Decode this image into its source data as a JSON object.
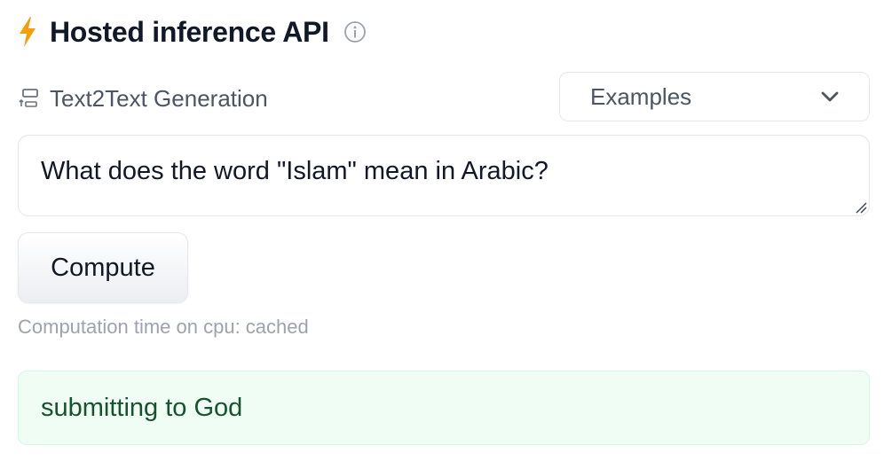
{
  "header": {
    "title": "Hosted inference API",
    "bolt_icon": "lightning-bolt-icon",
    "info_icon": "info-circle-icon",
    "accent_color": "#f59e0b"
  },
  "task": {
    "icon": "text2text-icon",
    "label": "Text2Text Generation"
  },
  "examples": {
    "label": "Examples",
    "icon": "chevron-down-icon"
  },
  "input": {
    "value": "What does the word \"Islam\" mean in Arabic?"
  },
  "compute": {
    "label": "Compute"
  },
  "status": {
    "computation_time": "Computation time on cpu: cached"
  },
  "output": {
    "text": "submitting to God",
    "background_color": "#f0fdf4",
    "text_color": "#14532d"
  }
}
